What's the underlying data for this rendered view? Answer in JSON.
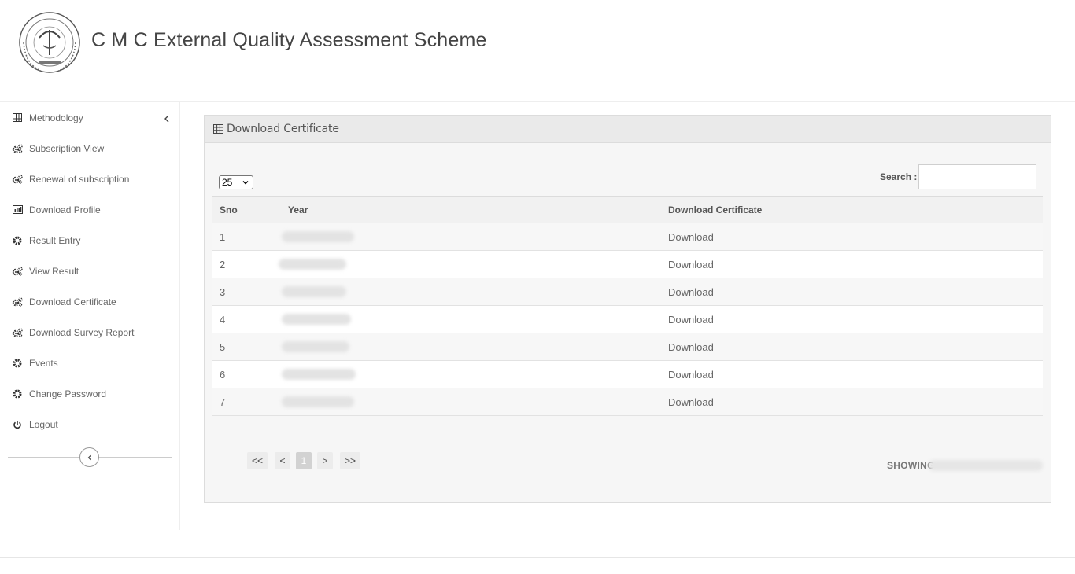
{
  "header": {
    "title": "C M C External Quality Assessment Scheme",
    "logo": "college-seal-logo"
  },
  "sidebar": {
    "items": [
      {
        "label": "Methodology",
        "icon": "table-icon"
      },
      {
        "label": "Subscription View",
        "icon": "cogs-icon"
      },
      {
        "label": "Renewal of subscription",
        "icon": "cogs-icon"
      },
      {
        "label": "Download Profile",
        "icon": "bar-chart-icon"
      },
      {
        "label": "Result Entry",
        "icon": "gear-icon"
      },
      {
        "label": "View Result",
        "icon": "cogs-icon"
      },
      {
        "label": "Download Certificate",
        "icon": "cogs-icon"
      },
      {
        "label": "Download Survey Report",
        "icon": "cogs-icon"
      },
      {
        "label": "Events",
        "icon": "gear-icon"
      },
      {
        "label": "Change Password",
        "icon": "gear-icon"
      },
      {
        "label": "Logout",
        "icon": "power-icon"
      }
    ]
  },
  "panel": {
    "title": "Download Certificate",
    "page_length": "25",
    "search_label": "Search :",
    "search_value": "",
    "columns": [
      "Sno",
      "Year",
      "Download Certificate"
    ],
    "rows": [
      {
        "sno": "1",
        "download": "Download"
      },
      {
        "sno": "2",
        "download": "Download"
      },
      {
        "sno": "3",
        "download": "Download"
      },
      {
        "sno": "4",
        "download": "Download"
      },
      {
        "sno": "5",
        "download": "Download"
      },
      {
        "sno": "6",
        "download": "Download"
      },
      {
        "sno": "7",
        "download": "Download"
      }
    ],
    "pagination": [
      "<<",
      "<",
      "1",
      ">",
      ">>"
    ],
    "current_page": "1",
    "showing_prefix": "SHOWING"
  },
  "colors": {
    "text": "#555555",
    "panel_bg": "#f3f3f3",
    "border": "#dcdcdc"
  }
}
